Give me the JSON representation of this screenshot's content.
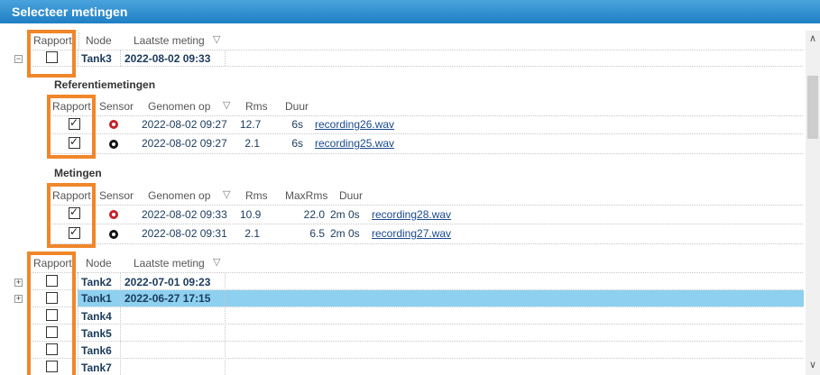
{
  "window": {
    "title": "Selecteer metingen"
  },
  "top_header": {
    "rapport": "Rapport",
    "node": "Node",
    "laatste": "Laatste meting",
    "sort": "▽"
  },
  "tank3": {
    "name": "Tank3",
    "date": "2022-08-02 09:33",
    "expander": "−"
  },
  "referentie": {
    "title": "Referentiemetingen",
    "headers": {
      "rapport": "Rapport",
      "sensor": "Sensor",
      "genomen": "Genomen op",
      "sort": "▽",
      "rms": "Rms",
      "duur": "Duur"
    },
    "rows": [
      {
        "checked": true,
        "sensor": "red",
        "date": "2022-08-02 09:27",
        "rms": "12.7",
        "duur": "6s",
        "file": "recording26.wav"
      },
      {
        "checked": true,
        "sensor": "black",
        "date": "2022-08-02 09:27",
        "rms": "2.1",
        "duur": "6s",
        "file": "recording25.wav"
      }
    ]
  },
  "metingen": {
    "title": "Metingen",
    "headers": {
      "rapport": "Rapport",
      "sensor": "Sensor",
      "genomen": "Genomen op",
      "sort": "▽",
      "rms": "Rms",
      "maxrms": "MaxRms",
      "duur": "Duur"
    },
    "rows": [
      {
        "checked": true,
        "sensor": "red",
        "date": "2022-08-02 09:33",
        "rms": "10.9",
        "maxrms": "22.0",
        "duur": "2m 0s",
        "file": "recording28.wav"
      },
      {
        "checked": true,
        "sensor": "black",
        "date": "2022-08-02 09:31",
        "rms": "2.1",
        "maxrms": "6.5",
        "duur": "2m 0s",
        "file": "recording27.wav"
      }
    ]
  },
  "bottom_header": {
    "rapport": "Rapport",
    "node": "Node",
    "laatste": "Laatste meting",
    "sort": "▽"
  },
  "tanks": [
    {
      "name": "Tank2",
      "date": "2022-07-01 09:23",
      "expander": "+"
    },
    {
      "name": "Tank1",
      "date": "2022-06-27 17:15",
      "expander": "+"
    },
    {
      "name": "Tank4",
      "date": ""
    },
    {
      "name": "Tank5",
      "date": ""
    },
    {
      "name": "Tank6",
      "date": ""
    },
    {
      "name": "Tank7",
      "date": ""
    }
  ],
  "scrollbar": {
    "up": "∧",
    "down": "∨"
  },
  "colors": {
    "highlight_orange": "#f0862a",
    "selected_row": "#8dd0f0",
    "title_blue": "#1f7fc4"
  }
}
